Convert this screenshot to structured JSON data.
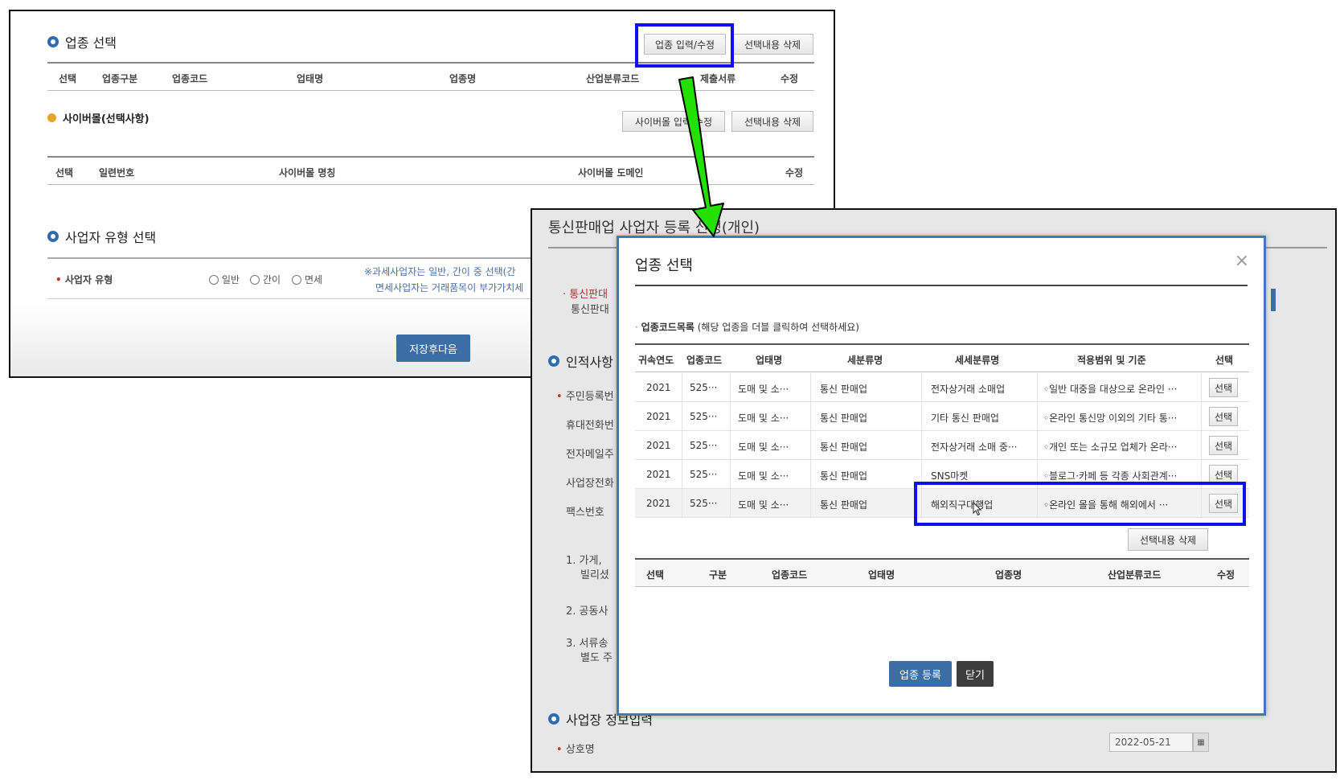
{
  "shot1": {
    "industry_section_title": "업종 선택",
    "industry_input_button": "업종 입력/수정",
    "delete_selected_button": "선택내용 삭제",
    "industry_table_headers": [
      "선택",
      "업종구분",
      "업종코드",
      "업태명",
      "업종명",
      "산업분류코드",
      "제출서류",
      "수정"
    ],
    "cybermall_title": "사이버몰(선택사항)",
    "cybermall_edit_button": "사이버몰 입력/수정",
    "cybermall_delete_button": "선택내용 삭제",
    "cybermall_table_headers": [
      "선택",
      "일련번호",
      "사이버몰 명칭",
      "사이버몰 도메인",
      "수정"
    ],
    "biz_type_section_title": "사업자 유형 선택",
    "biz_type_label": "사업자 유형",
    "biz_type_options": [
      "일반",
      "간이",
      "면세"
    ],
    "biz_type_note_1": "※과세사업자는 일반, 간이 중 선택(간",
    "biz_type_note_2": "면세사업자는 거래품목이 부가가치세",
    "save_next_button": "저장후다음"
  },
  "shot2": {
    "page_title": "통신판매업 사업자 등록 신청(개인)",
    "side_text_1": "· 통신판대",
    "side_text_2": "통신판대",
    "personal_section": "인적사항",
    "labels": [
      "주민등록번",
      "휴대전화번",
      "전자메일주",
      "사업장전화",
      "팩스번호"
    ],
    "notes": [
      "1. 가게,",
      "빌리셨",
      "2. 공동사",
      "3. 서류송",
      "별도 주"
    ],
    "workplace_section": "사업장 정보입력",
    "company_label": "상호명",
    "date_value": "2022-05-21"
  },
  "modal": {
    "title": "업종 선택",
    "close_icon": "×",
    "list_title_bold": "업종코드목록",
    "list_title_rest": " (해당 업종을 더블 클릭하여 선택하세요)",
    "code_headers": [
      "귀속연도",
      "업종코드",
      "업태명",
      "세분류명",
      "세세분류명",
      "적용범위 및 기준",
      "선택"
    ],
    "code_rows": [
      {
        "year": "2021",
        "code": "525···",
        "biz": "도매 및 소···",
        "sub": "통신 판매업",
        "subsub": "전자상거래 소매업",
        "scope": "◦일반 대중을 대상으로 온라인 ···",
        "select": "선택"
      },
      {
        "year": "2021",
        "code": "525···",
        "biz": "도매 및 소···",
        "sub": "통신 판매업",
        "subsub": "기타 통신 판매업",
        "scope": "◦온라인 통신망 이외의 기타 통···",
        "select": "선택"
      },
      {
        "year": "2021",
        "code": "525···",
        "biz": "도매 및 소···",
        "sub": "통신 판매업",
        "subsub": "전자상거래 소매 중···",
        "scope": "◦개인 또는 소규모 업체가 온라···",
        "select": "선택"
      },
      {
        "year": "2021",
        "code": "525···",
        "biz": "도매 및 소···",
        "sub": "통신 판매업",
        "subsub": "SNS마켓",
        "scope": "◦블로그·카페 등 각종 사회관계···",
        "select": "선택"
      },
      {
        "year": "2021",
        "code": "525···",
        "biz": "도매 및 소···",
        "sub": "통신 판매업",
        "subsub": "해외직구대행업",
        "scope": "◦온라인 몰을 통해 해외에서 ···",
        "select": "선택"
      }
    ],
    "delete_selected_button": "선택내용 삭제",
    "selected_headers": [
      "선택",
      "구분",
      "업종코드",
      "업태명",
      "업종명",
      "산업분류코드",
      "수정"
    ],
    "register_button": "업종 등록",
    "close_button": "닫기"
  },
  "colors": {
    "highlight_box": "#1010e8",
    "arrow_fill": "#22e000",
    "modal_border": "#3f76c9",
    "primary_button": "#3b6ea5"
  }
}
